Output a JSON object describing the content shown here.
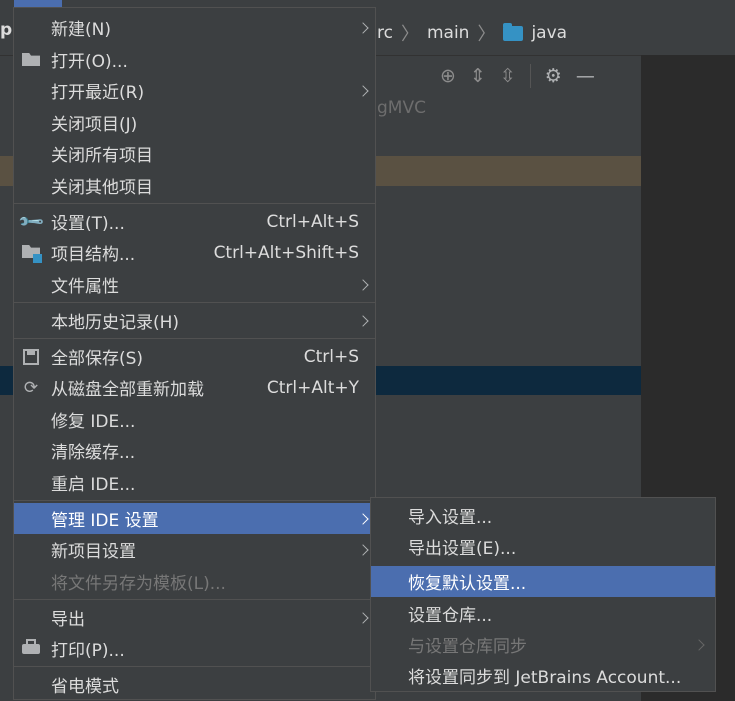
{
  "window": {
    "project_letter": "p"
  },
  "breadcrumb": {
    "items": [
      "rc",
      "main",
      "java"
    ]
  },
  "toolbar": {
    "icons": [
      "locate-icon",
      "expand-all-icon",
      "collapse-all-icon",
      "gear-icon",
      "minimize-icon"
    ]
  },
  "project_tree": {
    "ghost_text": "gMVC"
  },
  "file_menu": {
    "items": [
      {
        "label": "新建(N)",
        "submenu": true
      },
      {
        "label": "打开(O)...",
        "icon": "folder-open-icon"
      },
      {
        "label": "打开最近(R)",
        "submenu": true
      },
      {
        "label": "关闭项目(J)"
      },
      {
        "label": "关闭所有项目"
      },
      {
        "label": "关闭其他项目"
      },
      {
        "label": "设置(T)...",
        "icon": "wrench-icon",
        "shortcut": "Ctrl+Alt+S"
      },
      {
        "label": "项目结构...",
        "icon": "project-structure-icon",
        "shortcut": "Ctrl+Alt+Shift+S"
      },
      {
        "label": "文件属性",
        "submenu": true
      },
      {
        "label": "本地历史记录(H)",
        "submenu": true
      },
      {
        "label": "全部保存(S)",
        "icon": "save-icon",
        "shortcut": "Ctrl+S"
      },
      {
        "label": "从磁盘全部重新加载",
        "icon": "reload-icon",
        "shortcut": "Ctrl+Alt+Y"
      },
      {
        "label": "修复 IDE..."
      },
      {
        "label": "清除缓存..."
      },
      {
        "label": "重启 IDE..."
      },
      {
        "label": "管理 IDE 设置",
        "submenu": true,
        "selected": true
      },
      {
        "label": "新项目设置",
        "submenu": true
      },
      {
        "label": "将文件另存为模板(L)...",
        "disabled": true
      },
      {
        "label": "导出",
        "submenu": true
      },
      {
        "label": "打印(P)...",
        "icon": "printer-icon"
      },
      {
        "label": "省电模式"
      }
    ]
  },
  "settings_submenu": {
    "items": [
      {
        "label": "导入设置..."
      },
      {
        "label": "导出设置(E)..."
      },
      {
        "label": "恢复默认设置...",
        "selected": true
      },
      {
        "label": "设置仓库..."
      },
      {
        "label": "与设置仓库同步",
        "disabled": true,
        "submenu": true
      },
      {
        "label": "将设置同步到 JetBrains Account..."
      }
    ]
  },
  "colors": {
    "selection": "#4b6eaf",
    "menu_bg": "#3c3f41",
    "editor_bg": "#2b2b2b",
    "folder": "#3592c4"
  }
}
